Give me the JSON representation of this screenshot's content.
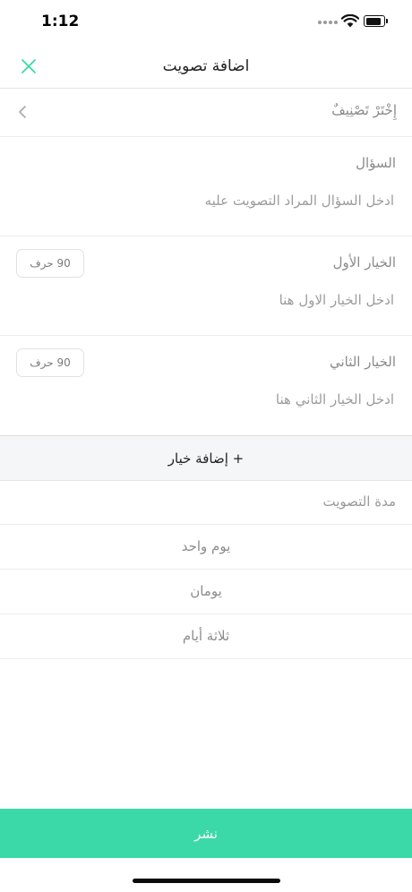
{
  "status_bar": {
    "time": "1:12"
  },
  "header": {
    "title": "اضافة تصويت"
  },
  "category": {
    "label": "إِخْتَرْ تَصْنِيفٌ"
  },
  "question": {
    "label": "السؤال",
    "placeholder": "ادخل السؤال المراد التصويت عليه"
  },
  "options": [
    {
      "label": "الخيار الأول",
      "placeholder": "ادخل الخيار الاول هنا",
      "char_limit": "90 حرف"
    },
    {
      "label": "الخيار الثاني",
      "placeholder": "ادخل الخيار الثاني هنا",
      "char_limit": "90 حرف"
    }
  ],
  "add_option_label": "+ إضافة خيار",
  "duration": {
    "label": "مدة التصويت",
    "options": [
      "يوم واحد",
      "يومان",
      "ثلاثة أيام"
    ]
  },
  "publish_label": "نشر",
  "colors": {
    "accent": "#3cd9a8",
    "close_icon": "#3cd9a8"
  }
}
